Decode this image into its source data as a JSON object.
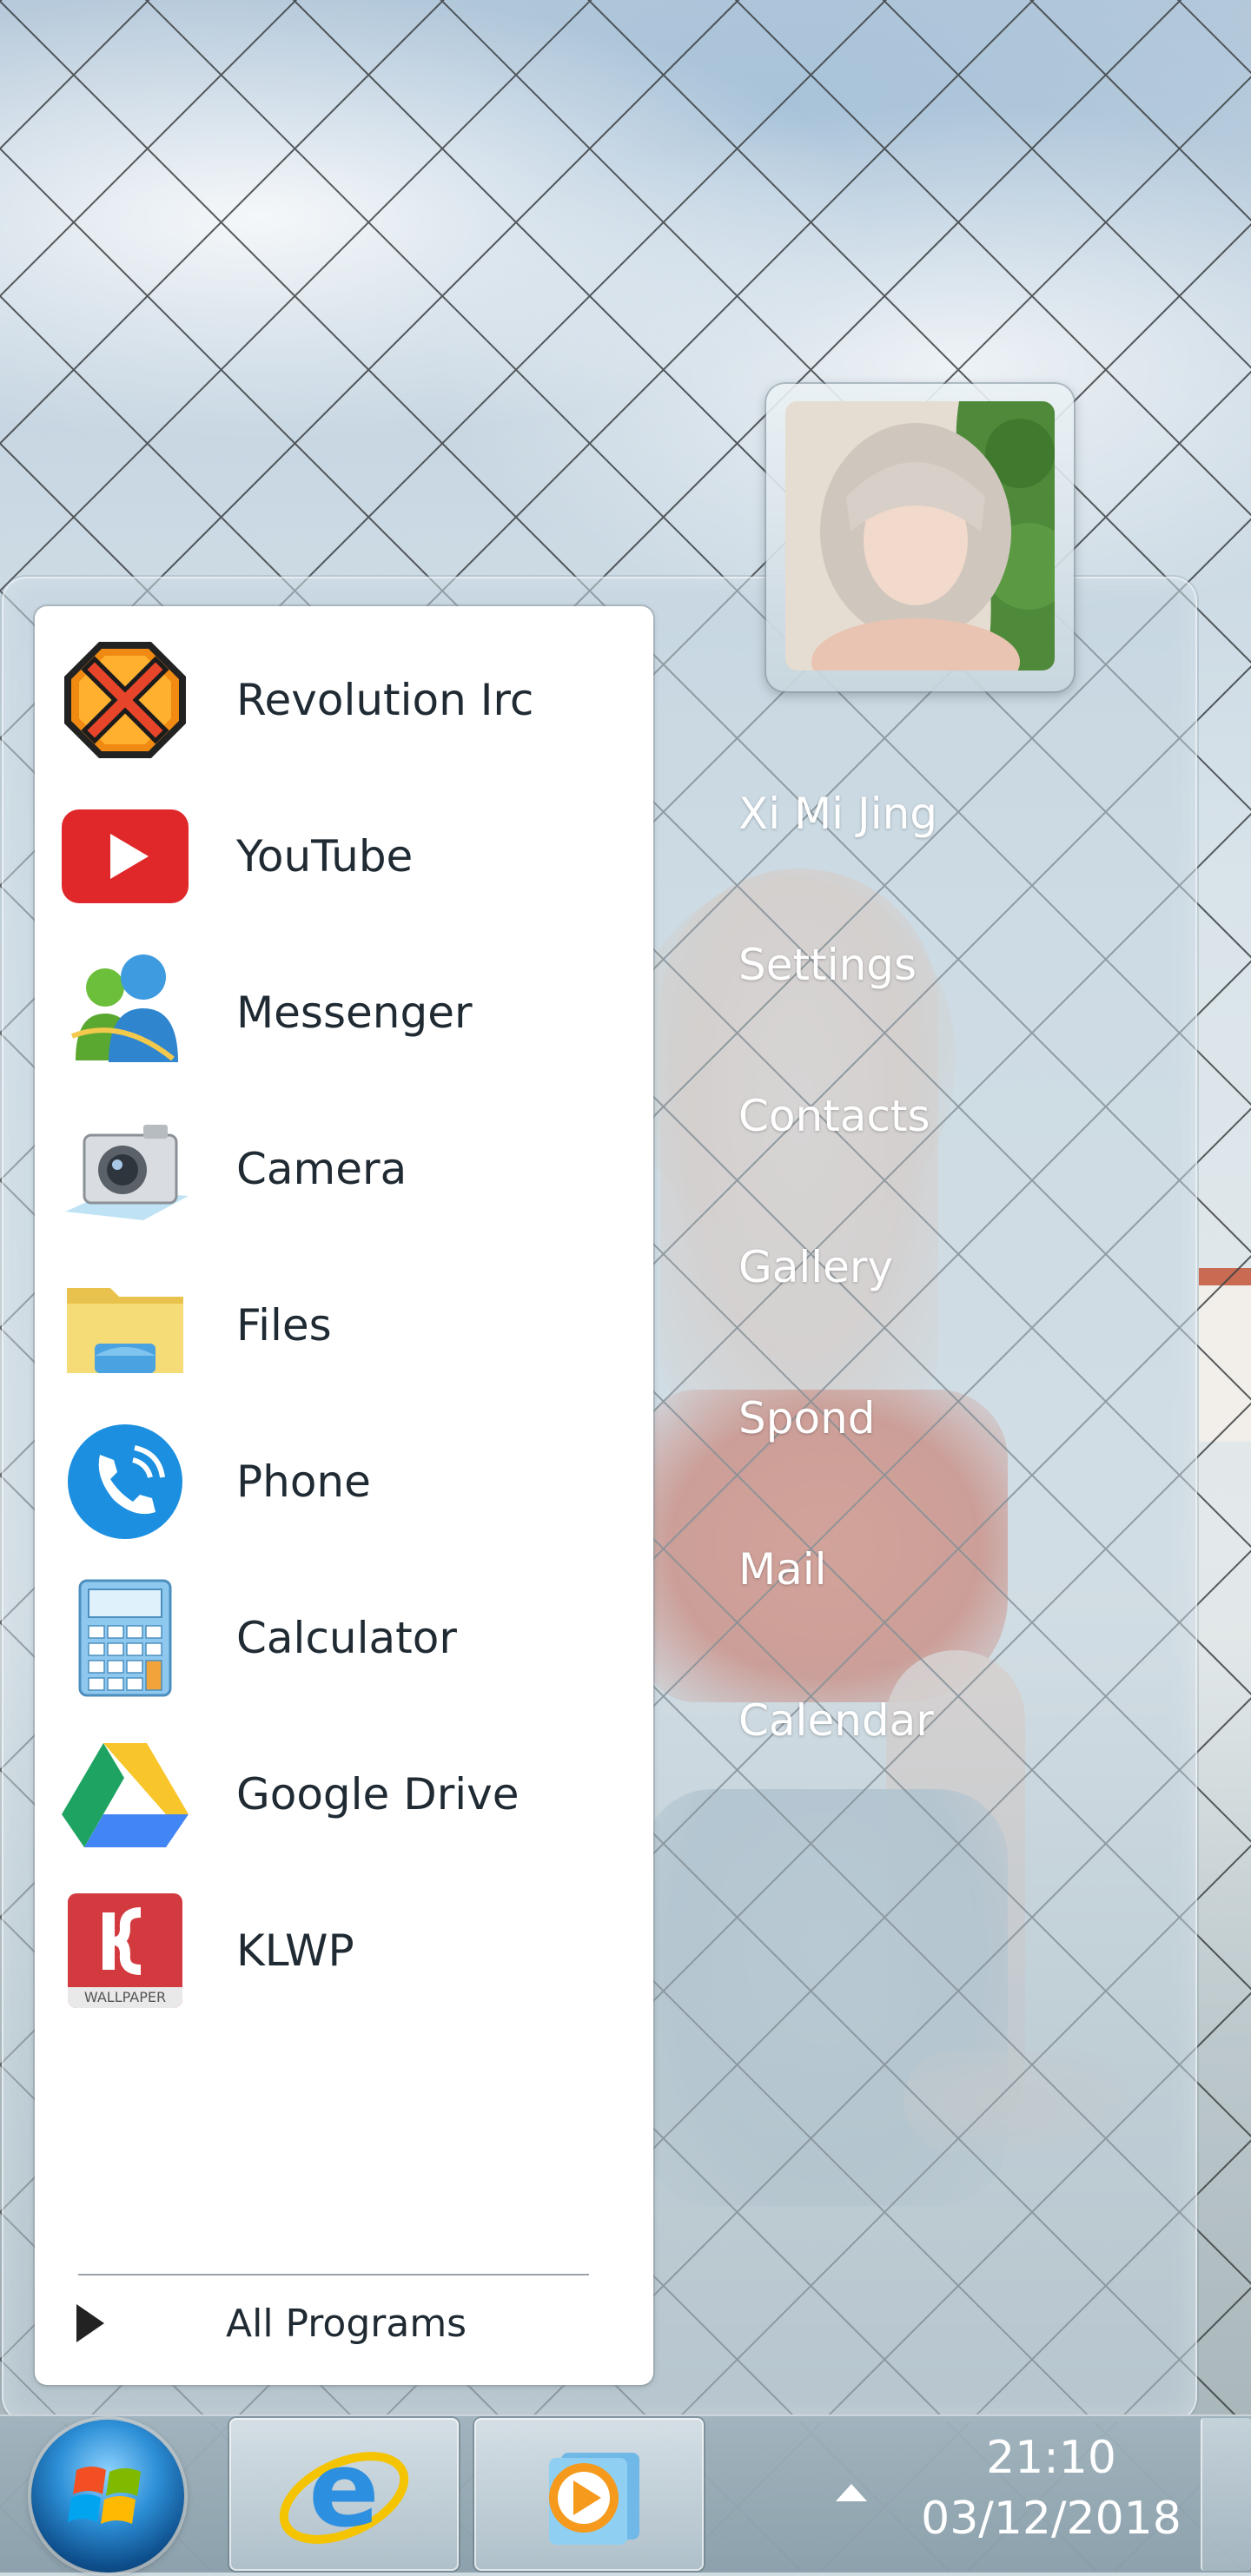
{
  "apps": [
    {
      "label": "Revolution Irc",
      "icon": "revolution-irc-icon"
    },
    {
      "label": "YouTube",
      "icon": "youtube-icon"
    },
    {
      "label": "Messenger",
      "icon": "messenger-icon"
    },
    {
      "label": "Camera",
      "icon": "camera-icon"
    },
    {
      "label": "Files",
      "icon": "folder-icon"
    },
    {
      "label": "Phone",
      "icon": "phone-icon"
    },
    {
      "label": "Calculator",
      "icon": "calculator-icon"
    },
    {
      "label": "Google Drive",
      "icon": "google-drive-icon"
    },
    {
      "label": "KLWP",
      "icon": "klwp-icon",
      "sublabel": "WALLPAPER"
    }
  ],
  "all_programs_label": "All Programs",
  "right_links": [
    "Xi Mi Jing",
    "Settings",
    "Contacts",
    "Gallery",
    "Spond",
    "Mail",
    "Calendar"
  ],
  "taskbar": {
    "time": "21:10",
    "date": "03/12/2018"
  },
  "colors": {
    "youtube_red": "#e62117",
    "right_link_text": "#ffffff"
  }
}
